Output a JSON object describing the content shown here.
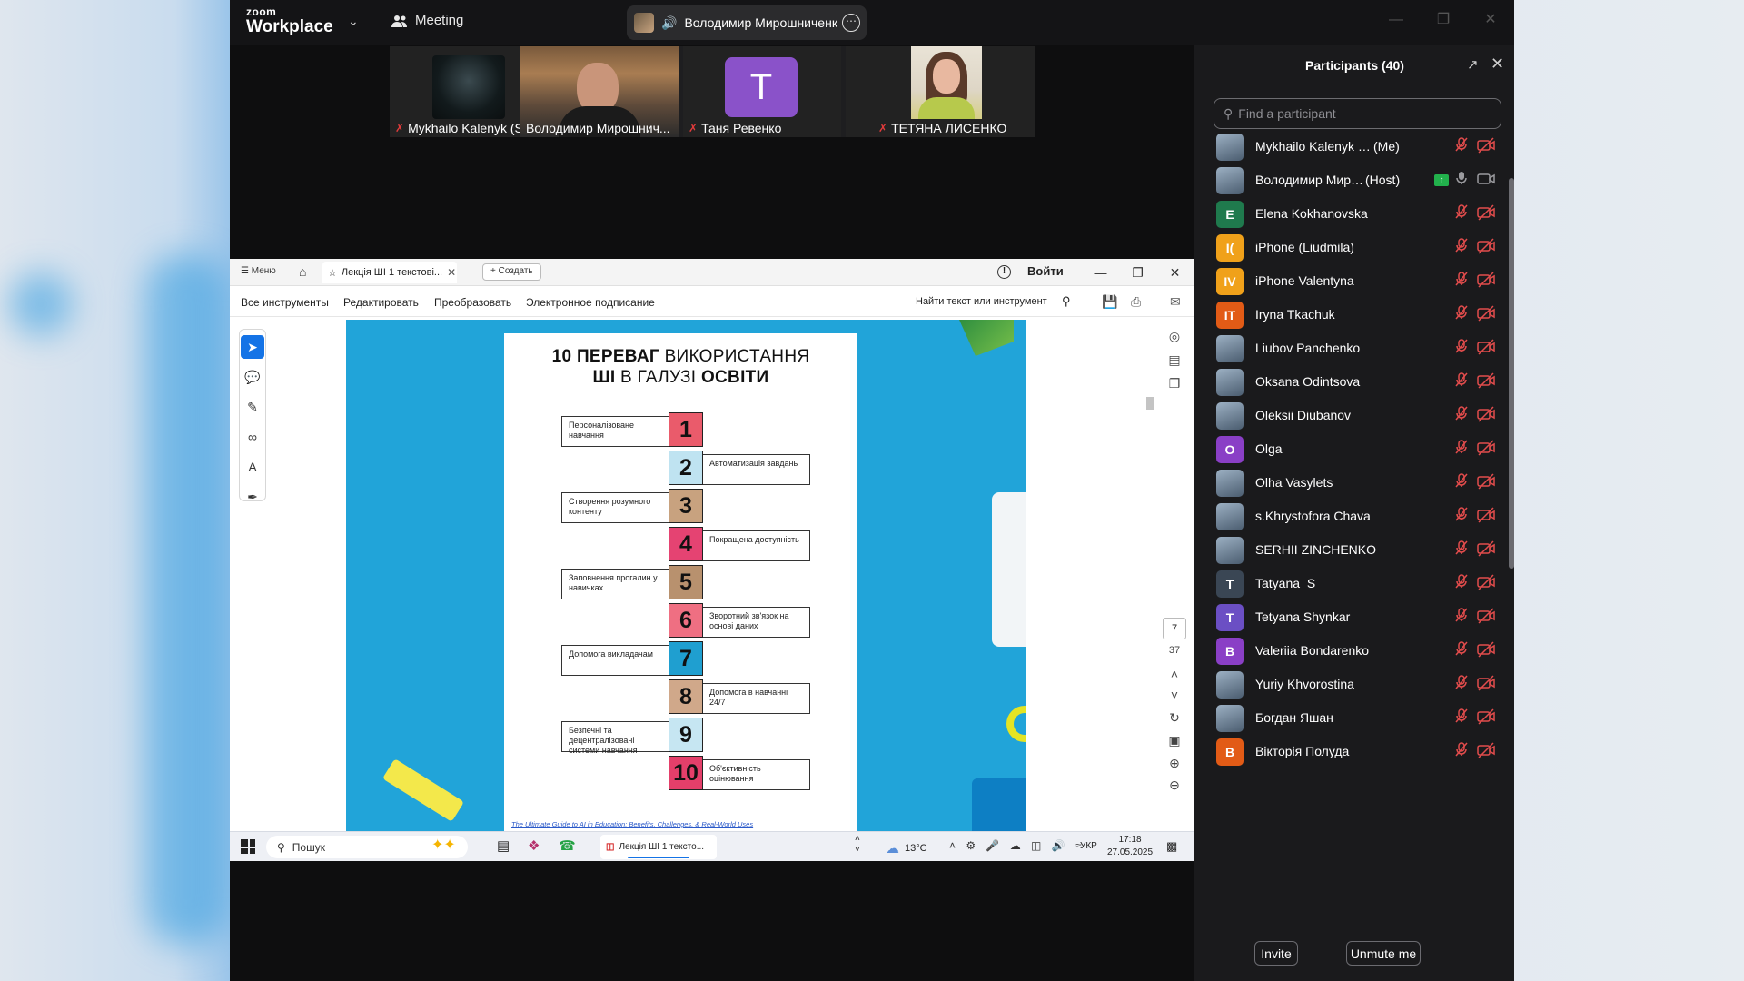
{
  "colors": {
    "zoom_bg": "#0e0e0f",
    "active_speaker_border": "#1fbf6b",
    "muted_red": "#e24c4c",
    "acrobat_blue": "#1473e6",
    "slide_bg": "#21a4d9"
  },
  "zoom": {
    "brand_top": "zoom",
    "brand_bottom": "Workplace",
    "meeting_label": "Meeting",
    "active_speaker": "Володимир Мирошниченк",
    "thumbnails": [
      {
        "name": "Mykhailo Kalenyk (Su...",
        "muted": true
      },
      {
        "name": "Володимир Мирошнич...",
        "muted": false,
        "active": true
      },
      {
        "name": "Таня Ревенко",
        "muted": true,
        "avatar_letter": "T"
      },
      {
        "name": "ТЕТЯНА ЛИСЕНКО",
        "muted": true
      }
    ]
  },
  "acrobat": {
    "menu_label": "Меню",
    "tab_title": "Лекція ШІ 1 текстові...",
    "create_label": "Создать",
    "login_label": "Войти",
    "tools": {
      "all_tools": "Все инструменты",
      "edit": "Редактировать",
      "convert": "Преобразовать",
      "esign": "Электронное подписание",
      "find": "Найти текст или инструмент"
    },
    "page_current": "7",
    "page_total": "37"
  },
  "slide": {
    "title_line1_bold": "10 ПЕРЕВАГ",
    "title_line1_thin": " ВИКОРИСТАННЯ",
    "title_line2_bold_a": "ШІ",
    "title_line2_thin": " В ГАЛУЗІ ",
    "title_line2_bold_b": "ОСВІТИ",
    "items": [
      {
        "num": "1",
        "text": "Персоналізоване навчання",
        "side": "left",
        "color": "#ea5b6b"
      },
      {
        "num": "2",
        "text": "Автоматизація завдань",
        "side": "right",
        "color": "#bfe3f1"
      },
      {
        "num": "3",
        "text": "Створення розумного контенту",
        "side": "left",
        "color": "#c8a27f"
      },
      {
        "num": "4",
        "text": "Покращена доступність",
        "side": "right",
        "color": "#e54372"
      },
      {
        "num": "5",
        "text": "Заповнення прогалин у навичках",
        "side": "left",
        "color": "#b8916e"
      },
      {
        "num": "6",
        "text": "Зворотний зв'язок на основі даних",
        "side": "right",
        "color": "#ef6f82"
      },
      {
        "num": "7",
        "text": "Допомога викладачам",
        "side": "left",
        "color": "#1f9fd0"
      },
      {
        "num": "8",
        "text": "Допомога в навчанні 24/7",
        "side": "right",
        "color": "#d0a88a"
      },
      {
        "num": "9",
        "text": "Безпечні та децентралізовані системи навчання",
        "side": "left",
        "color": "#c6e6f2"
      },
      {
        "num": "10",
        "text": "Об'єктивність оцінювання",
        "side": "right",
        "color": "#e43f6a"
      }
    ],
    "source_link": "The Ultimate Guide to AI in Education: Benefits, Challenges, & Real-World Uses"
  },
  "taskbar": {
    "search_label": "Пошук",
    "app_label": "Лекція ШІ 1 тексто...",
    "weather": "13°C",
    "lang": "УКР",
    "time": "17:18",
    "date": "27.05.2025"
  },
  "participants_panel": {
    "title": "Participants (40)",
    "search_placeholder": "Find a participant",
    "invite_label": "Invite",
    "unmute_label": "Unmute me",
    "participants": [
      {
        "name": "Mykhailo Kalenyk (Sumy, ...",
        "role": "(Me)",
        "avatar": "photo",
        "mic_muted": true,
        "video_off": true
      },
      {
        "name": "Володимир Мирош...",
        "role": "(Host)",
        "avatar": "photo",
        "mic_muted": false,
        "video_off": false,
        "sharing": true
      },
      {
        "name": "Elena Kokhanovska",
        "avatar_letter": "E",
        "avatar_color": "#1f7a4d",
        "mic_muted": true,
        "video_off": true
      },
      {
        "name": "iPhone (Liudmila)",
        "avatar_letter": "I(",
        "avatar_color": "#f0a11a",
        "mic_muted": true,
        "video_off": true
      },
      {
        "name": "iPhone Valentyna",
        "avatar_letter": "IV",
        "avatar_color": "#f0a11a",
        "mic_muted": true,
        "video_off": true
      },
      {
        "name": "Iryna Tkachuk",
        "avatar_letter": "IT",
        "avatar_color": "#e25b16",
        "mic_muted": true,
        "video_off": true
      },
      {
        "name": "Liubov Panchenko",
        "avatar": "photo",
        "mic_muted": true,
        "video_off": true
      },
      {
        "name": "Oksana Odintsova",
        "avatar": "photo",
        "mic_muted": true,
        "video_off": true
      },
      {
        "name": "Oleksii Diubanov",
        "avatar": "photo",
        "mic_muted": true,
        "video_off": true
      },
      {
        "name": "Olga",
        "avatar_letter": "O",
        "avatar_color": "#8a3fc6",
        "mic_muted": true,
        "video_off": true
      },
      {
        "name": "Olha Vasylets",
        "avatar": "photo",
        "mic_muted": true,
        "video_off": true
      },
      {
        "name": "s.Khrystofora Chava",
        "avatar": "photo",
        "mic_muted": true,
        "video_off": true
      },
      {
        "name": "SERHII ZINCHENKO",
        "avatar": "photo",
        "mic_muted": true,
        "video_off": true
      },
      {
        "name": "Tatyana_S",
        "avatar_letter": "T",
        "avatar_color": "#3a4654",
        "mic_muted": true,
        "video_off": true
      },
      {
        "name": "Tetyana Shynkar",
        "avatar_letter": "T",
        "avatar_color": "#6b4fc4",
        "mic_muted": true,
        "video_off": true
      },
      {
        "name": "Valeriia Bondarenko",
        "avatar_letter": "B",
        "avatar_color": "#8a3fc6",
        "mic_muted": true,
        "video_off": true
      },
      {
        "name": "Yuriy Khvorostina",
        "avatar": "photo",
        "mic_muted": true,
        "video_off": true
      },
      {
        "name": "Богдан Яшан",
        "avatar": "photo",
        "mic_muted": true,
        "video_off": true
      },
      {
        "name": "Вікторія Полуда",
        "avatar_letter": "B",
        "avatar_color": "#e25b16",
        "mic_muted": true,
        "video_off": true
      }
    ]
  }
}
